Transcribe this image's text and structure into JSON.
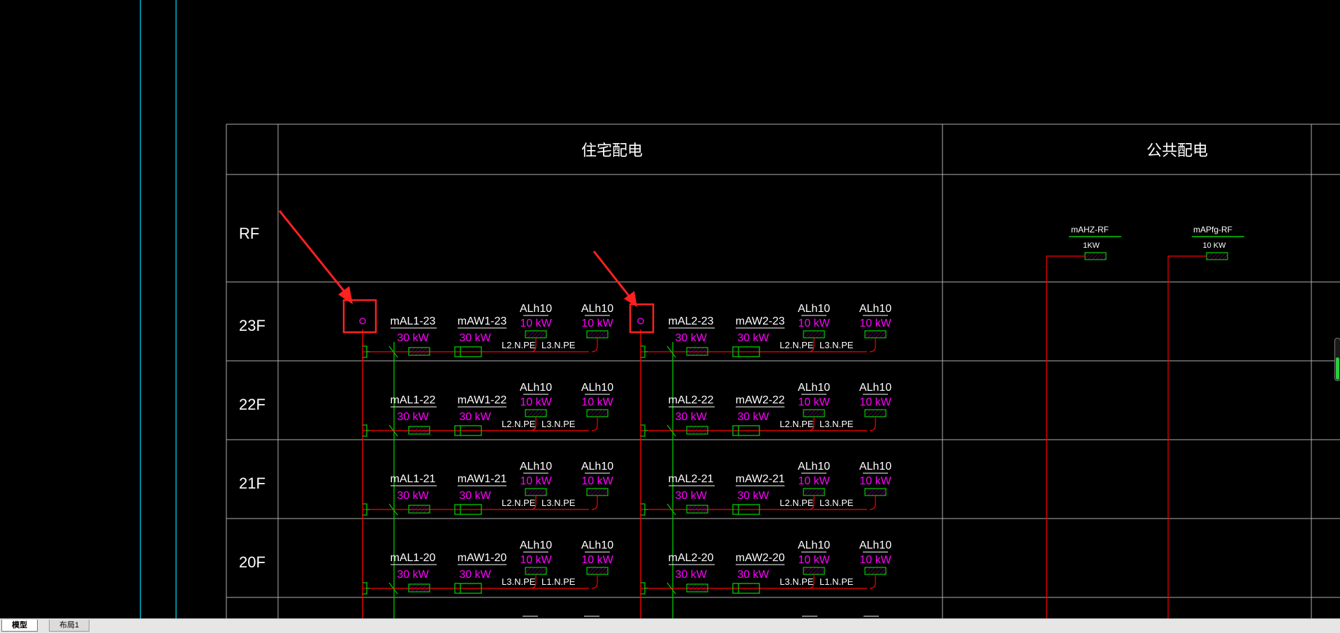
{
  "header": {
    "residential": "住宅配电",
    "public": "公共配电"
  },
  "floors": [
    {
      "label": "RF"
    },
    {
      "label": "23F",
      "num": "23",
      "wire1": "L2.N.PE",
      "wire2": "L3.N.PE"
    },
    {
      "label": "22F",
      "num": "22",
      "wire1": "L2.N.PE",
      "wire2": "L3.N.PE"
    },
    {
      "label": "21F",
      "num": "21",
      "wire1": "L2.N.PE",
      "wire2": "L3.N.PE"
    },
    {
      "label": "20F",
      "num": "20",
      "wire1": "L3.N.PE",
      "wire2": "L1.N.PE"
    }
  ],
  "circuits": {
    "left": {
      "al": "mAL1",
      "aw": "mAW1"
    },
    "right": {
      "al": "mAL2",
      "aw": "mAW2"
    },
    "al_power": "30 kW",
    "aw_power": "30 kW",
    "alh_name": "ALh10",
    "alh_power": "10 kW"
  },
  "public_panels": [
    {
      "name": "mAHZ-RF",
      "power": "1KW"
    },
    {
      "name": "mAPfg-RF",
      "power": "10 KW"
    }
  ],
  "tabs": [
    {
      "label": "模型"
    },
    {
      "label": "布局1"
    }
  ],
  "colors": {
    "grid": "#b0b0b0",
    "text": "#ffffff",
    "magenta": "#ff00ff",
    "red": "#ff0000",
    "green": "#00cc00",
    "cyan": "#00e5ff",
    "annotation": "#ff2020"
  },
  "icons": {
    "annotation_arrow": "red-arrow-icon",
    "annotation_box": "red-highlight-box"
  }
}
